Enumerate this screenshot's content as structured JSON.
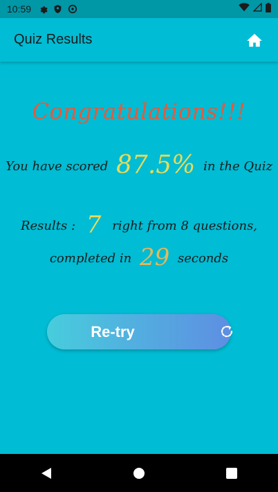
{
  "status_bar": {
    "time": "10:59",
    "icons_left": [
      "gear-icon",
      "shield-icon",
      "sync-circle-icon"
    ],
    "icons_right": [
      "wifi-icon",
      "signal-icon",
      "battery-icon"
    ]
  },
  "app_bar": {
    "title": "Quiz Results",
    "home_icon": "home-icon"
  },
  "content": {
    "congrats": "Congratulations!!!",
    "score_prefix": "You have scored",
    "score_value": "87.5%",
    "score_suffix": "in the Quiz",
    "results_label": "Results :",
    "right_count": "7",
    "results_middle": "right from 8 questions,",
    "completed_prefix": "completed in",
    "seconds_value": "29",
    "seconds_suffix": "seconds"
  },
  "retry_button": {
    "label": "Re-try",
    "icon": "refresh-icon"
  },
  "colors": {
    "background": "#00BCD4",
    "status_bar": "#0097A7",
    "congrats": "#E65A3C",
    "highlight": "#E6DC5A",
    "button_gradient_start": "#47CDDD",
    "button_gradient_end": "#5E8EE2"
  },
  "nav_bar": [
    "back-icon",
    "home-circle-icon",
    "recents-icon"
  ]
}
